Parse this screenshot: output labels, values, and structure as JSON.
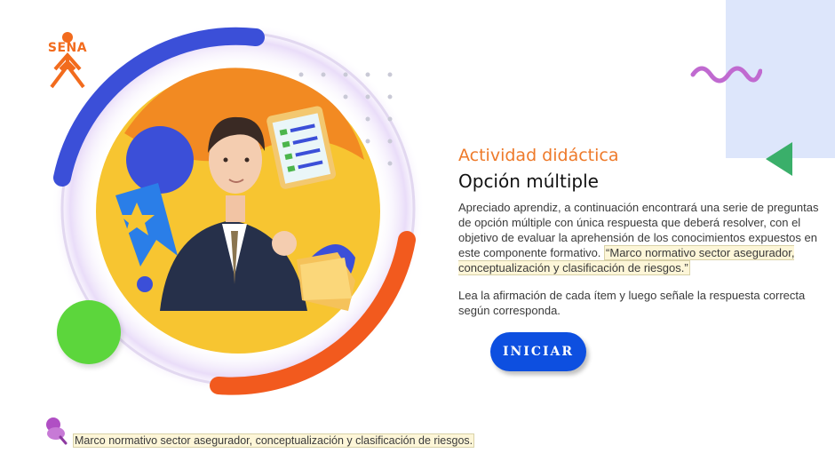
{
  "brand": {
    "logo_text": "SENA"
  },
  "activity": {
    "kicker": "Actividad didáctica",
    "title": "Opción múltiple",
    "intro_lead": "Apreciado aprendiz, a continuación encontrará una serie de preguntas de opción múltiple con única respuesta que deberá resolver, con el objetivo de evaluar la aprehensión de los conocimientos expuestos en este componente formativo. ",
    "intro_highlight": "“Marco normativo sector asegurador, conceptualización y clasificación de riesgos.”",
    "instruction": "Lea la afirmación de cada ítem y luego señale la respuesta correcta según corresponda.",
    "start_label": "INICIAR"
  },
  "footer": {
    "caption": "Marco normativo sector asegurador, conceptualización y clasificación de riesgos."
  },
  "colors": {
    "accent_orange": "#ee7a2a",
    "button_blue": "#0d4fe0",
    "arc_blue": "#3b4fd8",
    "arc_orange": "#f25a1e",
    "deco_green": "#5cd63c",
    "deco_purple": "#c06ad0",
    "panel_blue": "#dde6fb"
  },
  "icons": [
    "sena-logo-icon",
    "wave-icon",
    "triangle-icon",
    "pin-icon",
    "star-ribbon-icon",
    "clipboard-icon",
    "folder-icon"
  ]
}
